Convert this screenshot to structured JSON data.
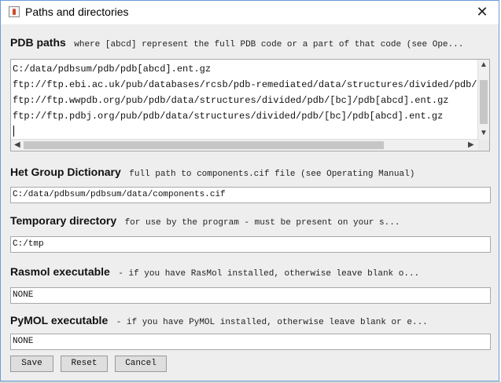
{
  "window": {
    "title": "Paths and directories",
    "close_glyph": "✕",
    "icon": "java-cup-icon"
  },
  "pdb_paths": {
    "label": "PDB paths",
    "hint": "where [abcd] represent the full PDB code or a part of that code (see Ope...",
    "lines": [
      "C:/data/pdbsum/pdb/pdb[abcd].ent.gz",
      "ftp://ftp.ebi.ac.uk/pub/databases/rcsb/pdb-remediated/data/structures/divided/pdb/[bc]",
      "ftp://ftp.wwpdb.org/pub/pdb/data/structures/divided/pdb/[bc]/pdb[abcd].ent.gz",
      "ftp://ftp.pdbj.org/pub/pdb/data/structures/divided/pdb/[bc]/pdb[abcd].ent.gz"
    ]
  },
  "het_dict": {
    "label": "Het Group Dictionary",
    "hint": "full path to components.cif file (see Operating Manual)",
    "value": "C:/data/pdbsum/pdbsum/data/components.cif"
  },
  "temp_dir": {
    "label": "Temporary directory",
    "hint": "for use by the program - must be present on your s...",
    "value": "C:/tmp"
  },
  "rasmol": {
    "label": "Rasmol executable",
    "hint": "- if you have RasMol installed, otherwise leave blank o...",
    "value": "NONE"
  },
  "pymol": {
    "label": "PyMOL executable",
    "hint": "- if you have PyMOL installed, otherwise leave blank or e...",
    "value": "NONE"
  },
  "buttons": {
    "save": "Save",
    "reset": "Reset",
    "cancel": "Cancel"
  }
}
